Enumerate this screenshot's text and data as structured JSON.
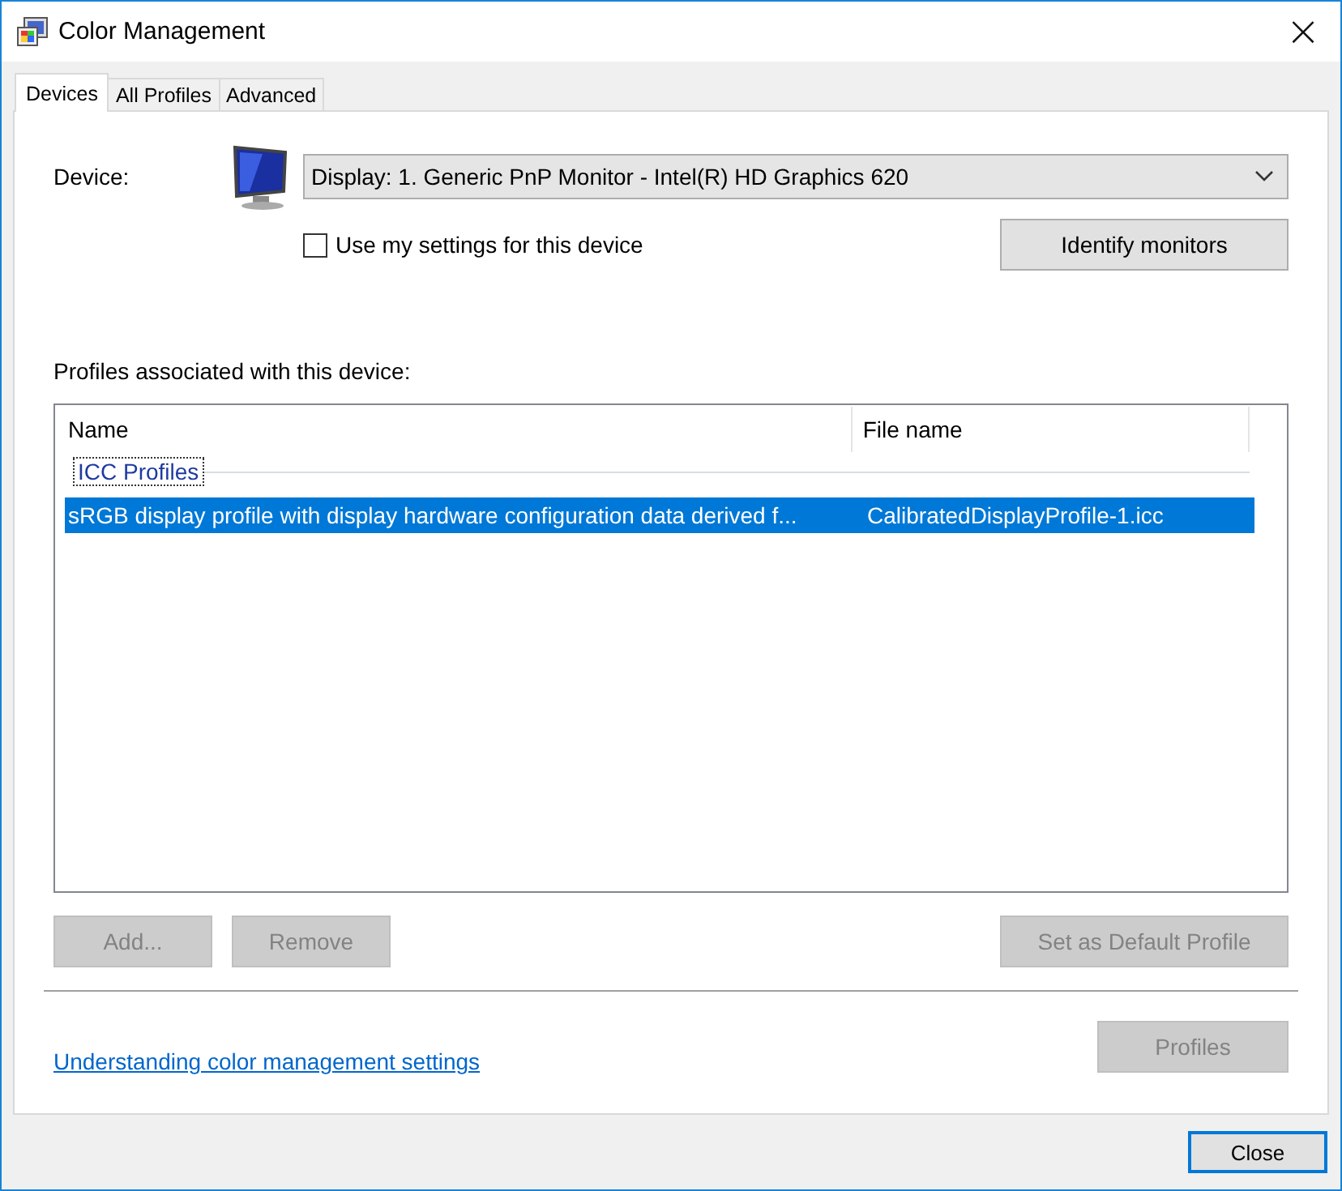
{
  "window": {
    "title": "Color Management",
    "close": "×"
  },
  "tabs": [
    {
      "label": "Devices",
      "selected": true
    },
    {
      "label": "All Profiles",
      "selected": false
    },
    {
      "label": "Advanced",
      "selected": false
    }
  ],
  "device": {
    "label": "Device:",
    "value": "Display: 1. Generic PnP Monitor - Intel(R) HD Graphics 620"
  },
  "use_my_settings": {
    "label": "Use my settings for this device",
    "checked": false
  },
  "identify_button": {
    "label": "Identify monitors",
    "disabled": false
  },
  "profiles_label": "Profiles associated with this device:",
  "profile_list": {
    "columns": [
      "Name",
      "File name"
    ],
    "group": "ICC Profiles",
    "rows": [
      {
        "name": "sRGB display profile with display hardware configuration data derived f...",
        "file": "CalibratedDisplayProfile-1.icc",
        "selected": true
      }
    ]
  },
  "list_buttons": [
    {
      "label": "Add...",
      "disabled": true
    },
    {
      "label": "Remove",
      "disabled": true
    },
    {
      "label": "Set as Default Profile",
      "disabled": true
    }
  ],
  "link": "Understanding color management settings",
  "profiles_button": {
    "label": "Profiles",
    "disabled": true
  },
  "footer_buttons": [
    {
      "label": "Close",
      "disabled": false
    }
  ]
}
